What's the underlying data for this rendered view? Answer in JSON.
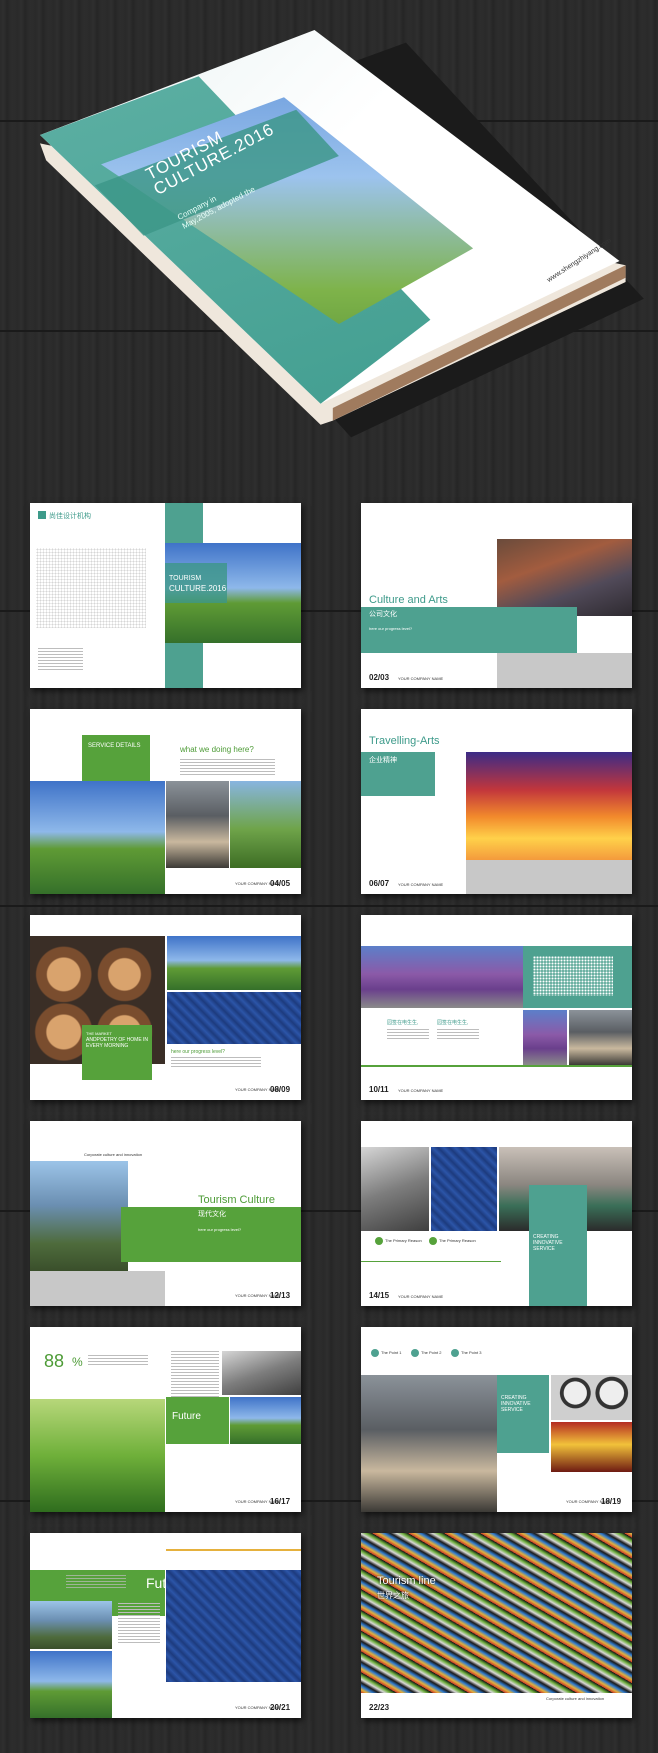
{
  "cover": {
    "title_line1": "TOURISM",
    "title_line2": "CULTURE.2016",
    "subtitle_line1": "Company in",
    "subtitle_line2": "May,2005, adopted the",
    "url": "www.shengzhiyang.com"
  },
  "spreads": {
    "s1": {
      "logo": "尚佳设计机构",
      "title1": "TOURISM",
      "title2": "CULTURE.2016"
    },
    "s2": {
      "title": "Culture and Arts",
      "subtitle": "公司文化",
      "tagline": "here our progress level?",
      "page": "02/03",
      "company": "YOUR COMPANY NAME"
    },
    "s3": {
      "box_label": "SERVICE DETAILS",
      "heading": "what we doing here?",
      "page": "04/05",
      "company": "YOUR COMPANY NAME"
    },
    "s4": {
      "title": "Travelling-Arts",
      "subtitle": "企业精神",
      "page": "06/07",
      "company": "YOUR COMPANY NAME"
    },
    "s5": {
      "quote_line1": "THE MARKET",
      "quote_line2": "ANDPOETRY OF HOME IN",
      "quote_line3": "EVERY MORNING",
      "tagline": "here our progress level?",
      "page": "08/09",
      "company": "YOUR COMPANY NAME"
    },
    "s6": {
      "caption1": "园签在电生生,",
      "caption2": "园签在电生生,",
      "page": "10/11",
      "company": "YOUR COMPANY NAME"
    },
    "s7": {
      "kicker": "Corporate culture and innovation",
      "title": "Tourism Culture",
      "subtitle": "现代文化",
      "tagline": "here our progress level?",
      "page": "12/13",
      "company": "YOUR COMPANY NAME"
    },
    "s8": {
      "reason1": "The Primary Reason",
      "reason2": "The Primary Reason",
      "box1": "CREATING",
      "box2": "INNOVATIVE",
      "box3": "SERVICE",
      "page": "14/15",
      "company": "YOUR COMPANY NAME"
    },
    "s9": {
      "percent_value": "88",
      "percent_sign": "%",
      "title": "Future",
      "page": "16/17",
      "company": "YOUR COMPANY NAME"
    },
    "s10": {
      "point1": "The Point 1",
      "point2": "The Point 2",
      "point3": "The Point 3",
      "box1": "CREATING",
      "box2": "INNOVATIVE",
      "box3": "SERVICE",
      "page": "18/19",
      "company": "YOUR COMPANY NAME"
    },
    "s11": {
      "title": "Future",
      "page": "20/21",
      "company": "YOUR COMPANY NAME"
    },
    "s12": {
      "title": "Tourism line",
      "subtitle": "世界之旅",
      "kicker": "Corporate culture and innovation",
      "page": "22/23"
    }
  }
}
